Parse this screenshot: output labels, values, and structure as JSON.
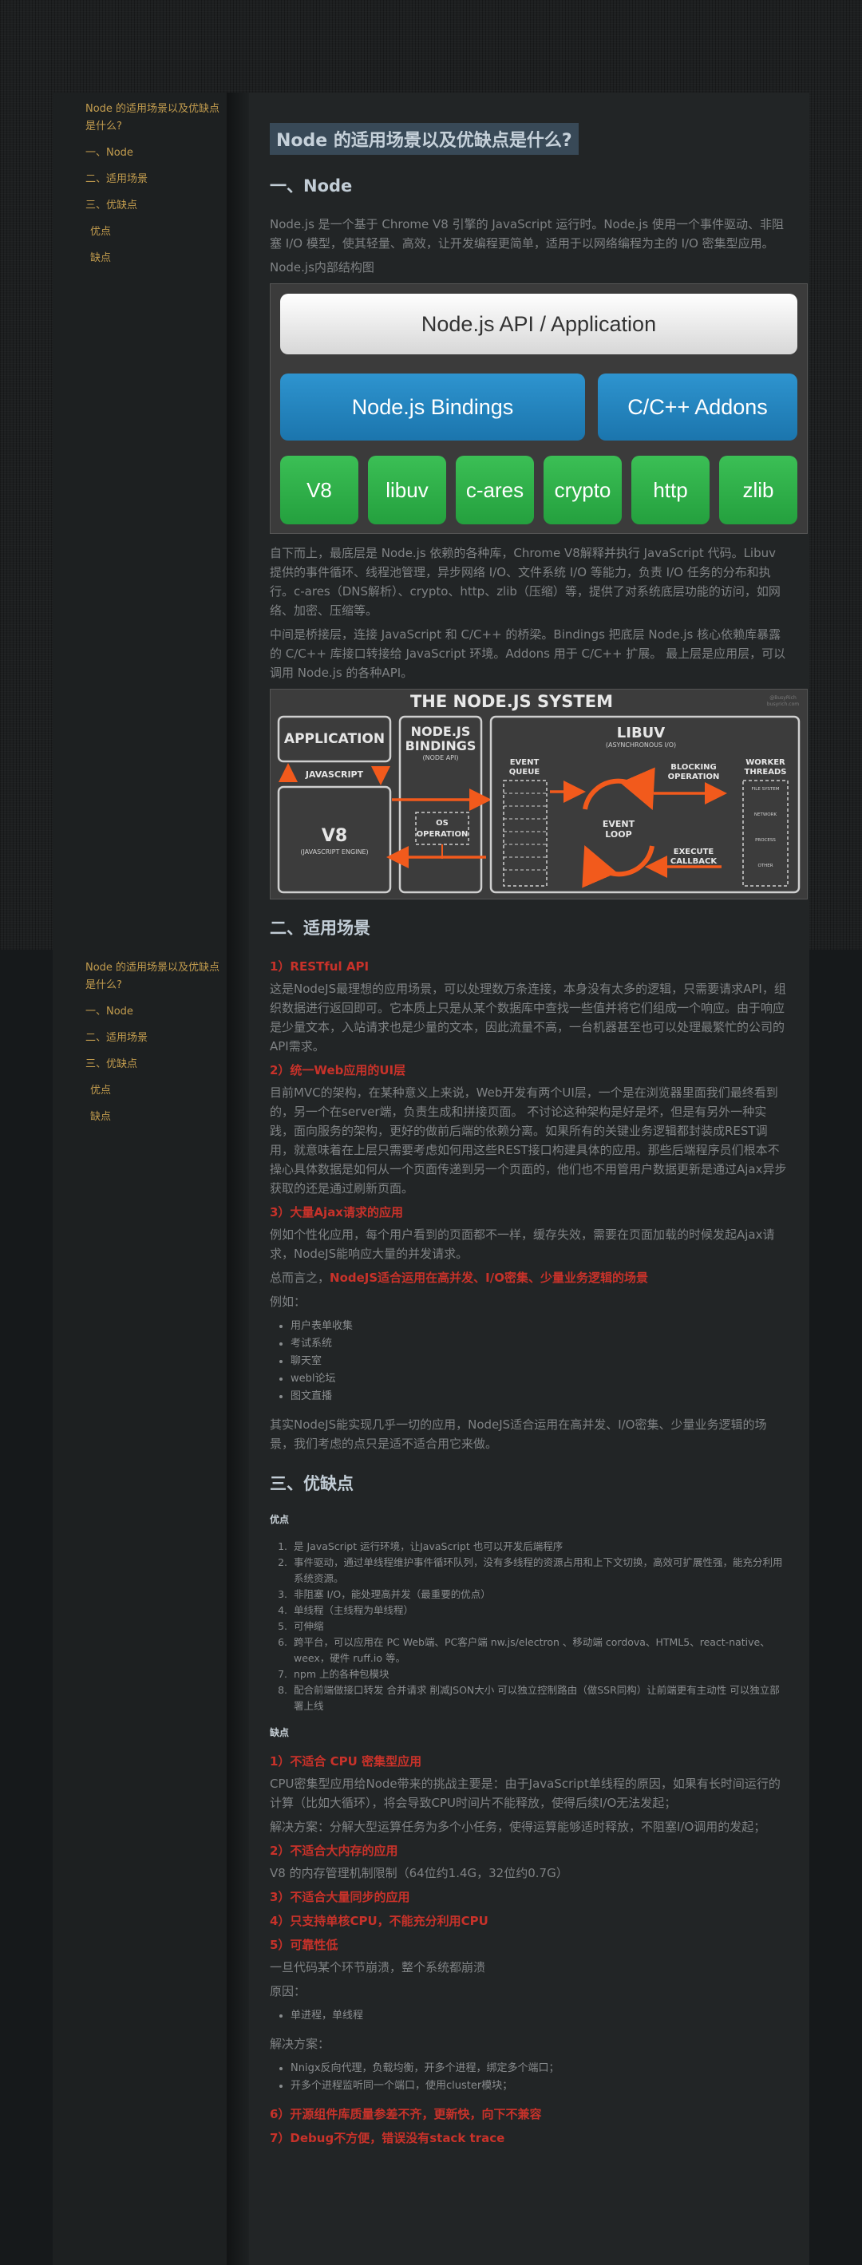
{
  "toc": {
    "title": "Node 的适用场景以及优缺点是什么?",
    "items": [
      "一、Node",
      "二、适用场景",
      "三、优缺点",
      "优点",
      "缺点"
    ]
  },
  "article": {
    "title": "Node 的适用场景以及优缺点是什么?",
    "s1": {
      "heading": "一、Node",
      "p1": "Node.js 是一个基于 Chrome V8 引擎的 JavaScript 运行时。Node.js 使用一个事件驱动、非阻塞 I/O 模型，使其轻量、高效，让开发编程更简单，适用于以网络编程为主的 I/O 密集型应用。",
      "p2": "Node.js内部结构图",
      "diagram1": {
        "api": "Node.js API / Application",
        "bindings": "Node.js Bindings",
        "addons": "C/C++ Addons",
        "libs": [
          "V8",
          "libuv",
          "c-ares",
          "crypto",
          "http",
          "zlib"
        ]
      },
      "p3": "自下而上，最底层是 Node.js 依赖的各种库，Chrome V8解释并执行 JavaScript 代码。Libuv 提供的事件循环、线程池管理，异步网络 I/O、文件系统 I/O 等能力，负责 I/O 任务的分布和执行。c-ares（DNS解析）、crypto、http、zlib（压缩）等，提供了对系统底层功能的访问，如网络、加密、压缩等。",
      "p4": "中间是桥接层，连接 JavaScript 和 C/C++ 的桥梁。Bindings 把底层 Node.js 核心依赖库暴露的 C/C++ 库接口转接给 JavaScript 环境。Addons 用于 C/C++ 扩展。 最上层是应用层，可以调用 Node.js 的各种API。",
      "diagram2": {
        "title": "THE NODE.JS SYSTEM",
        "credit": "@BusyRich\nbusyrich.com",
        "application": "APPLICATION",
        "javascript": "JAVASCRIPT",
        "v8": "V8",
        "v8sub": "(JAVASCRIPT ENGINE)",
        "bindings": "NODE.JS BINDINGS",
        "bindings_sub": "(NODE API)",
        "os": "OS OPERATION",
        "libuv": "LIBUV",
        "libuv_sub": "(ASYNCHRONOUS I/O)",
        "event_queue": "EVENT QUEUE",
        "event_loop": "EVENT LOOP",
        "blocking": "BLOCKING OPERATION",
        "execute": "EXECUTE CALLBACK",
        "workers": "WORKER THREADS",
        "worker_items": [
          "FILE SYSTEM",
          "NETWORK",
          "PROCESS",
          "OTHER"
        ]
      }
    },
    "s2": {
      "heading": "二、适用场景",
      "h1": "1）RESTful API",
      "p1": "这是NodeJS最理想的应用场景，可以处理数万条连接，本身没有太多的逻辑，只需要请求API，组织数据进行返回即可。它本质上只是从某个数据库中查找一些值并将它们组成一个响应。由于响应是少量文本，入站请求也是少量的文本，因此流量不高，一台机器甚至也可以处理最繁忙的公司的API需求。",
      "h2": "2）统一Web应用的UI层",
      "p2": "目前MVC的架构，在某种意义上来说，Web开发有两个UI层，一个是在浏览器里面我们最终看到的，另一个在server端，负责生成和拼接页面。 不讨论这种架构是好是坏，但是有另外一种实践，面向服务的架构，更好的做前后端的依赖分离。如果所有的关键业务逻辑都封装成REST调用，就意味着在上层只需要考虑如何用这些REST接口构建具体的应用。那些后端程序员们根本不操心具体数据是如何从一个页面传递到另一个页面的，他们也不用管用户数据更新是通过Ajax异步获取的还是通过刷新页面。",
      "h3": "3）大量Ajax请求的应用",
      "p3": "例如个性化应用，每个用户看到的页面都不一样，缓存失效，需要在页面加载的时候发起Ajax请求，NodeJS能响应大量的并发请求。",
      "summary_prefix": "总而言之，",
      "summary_red": "NodeJS适合运用在高并发、I/O密集、少量业务逻辑的场景",
      "example": "例如：",
      "examples": [
        "用户表单收集",
        "考试系统",
        "聊天室",
        "webl论坛",
        "图文直播"
      ],
      "p4": "其实NodeJS能实现几乎一切的应用，NodeJS适合运用在高并发、I/O密集、少量业务逻辑的场景，我们考虑的点只是适不适合用它来做。"
    },
    "s3": {
      "heading": "三、优缺点",
      "pros_label": "优点",
      "pros": [
        "是 JavaScript 运行环境，让JavaScript 也可以开发后端程序",
        "事件驱动，通过单线程维护事件循环队列，没有多线程的资源占用和上下文切换，高效可扩展性强，能充分利用系统资源。",
        "非阻塞 I/O，能处理高并发（最重要的优点）",
        "单线程（主线程为单线程）",
        "可伸缩",
        "跨平台，可以应用在 PC Web端、PC客户端 nw.js/electron 、移动端 cordova、HTML5、react-native、weex，硬件 ruff.io 等。",
        "npm 上的各种包模块",
        "配合前端做接口转发 合并请求 削减JSON大小 可以独立控制路由（做SSR同构）让前端更有主动性 可以独立部署上线"
      ],
      "cons_label": "缺点",
      "c1": "1）不适合 CPU 密集型应用",
      "c1p1": "CPU密集型应用给Node带来的挑战主要是：由于JavaScript单线程的原因，如果有长时间运行的计算（比如大循环），将会导致CPU时间片不能释放，使得后续I/O无法发起；",
      "c1p2": "解决方案：分解大型运算任务为多个小任务，使得运算能够适时释放，不阻塞I/O调用的发起；",
      "c2": "2）不适合大内存的应用",
      "c2p": "V8 的内存管理机制限制（64位约1.4G，32位约0.7G）",
      "c3": "3）不适合大量同步的应用",
      "c4": "4）只支持单核CPU，不能充分利用CPU",
      "c5": "5）可靠性低",
      "c5p": "一旦代码某个环节崩溃，整个系统都崩溃",
      "cause_label": "原因：",
      "causes": [
        "单进程，单线程"
      ],
      "solution_label": "解决方案：",
      "solutions": [
        "Nnigx反向代理，负载均衡，开多个进程，绑定多个端口；",
        "开多个进程监听同一个端口，使用cluster模块；"
      ],
      "c6": "6）开源组件库质量参差不齐，更新快，向下不兼容",
      "c7": "7）Debug不方便，错误没有stack trace"
    }
  }
}
